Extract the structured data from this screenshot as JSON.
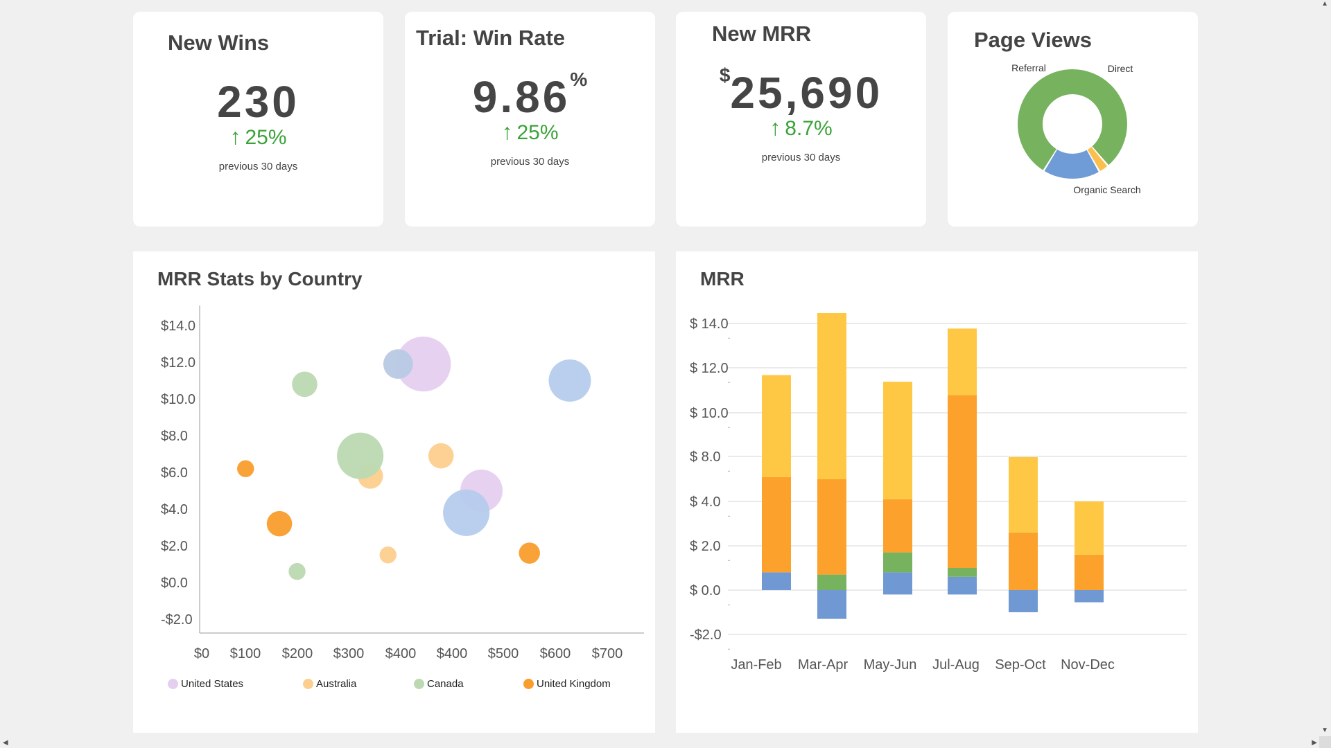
{
  "kpis": {
    "new_wins": {
      "title": "New Wins",
      "value": "230",
      "arrow": "↑",
      "change": "25%",
      "period": "previous 30 days"
    },
    "win_rate": {
      "title": "Trial: Win Rate",
      "value": "9.86",
      "suffix": "%",
      "arrow": "↑",
      "change": "25%",
      "period": "previous 30 days"
    },
    "new_mrr": {
      "title": "New MRR",
      "prefix": "$",
      "value": "25,690",
      "arrow": "↑",
      "change": "8.7%",
      "period": "previous 30 days"
    },
    "accent_color": "#3aa338"
  },
  "page_views": {
    "title": "Page Views"
  },
  "mrr_by_country": {
    "title": "MRR Stats by Country"
  },
  "mrr": {
    "title": "MRR"
  },
  "chart_data": [
    {
      "type": "pie",
      "donut": true,
      "slices": [
        {
          "label": "Organic Search",
          "value": 80,
          "color": "#77b25e"
        },
        {
          "label": "Referral",
          "value": 3,
          "color": "#fdbf4b"
        },
        {
          "label": "Direct",
          "value": 17,
          "color": "#6f9bd6"
        }
      ]
    },
    {
      "type": "scatter",
      "bubble": true,
      "xlim": [
        0,
        700
      ],
      "ylim": [
        -2,
        14
      ],
      "x_ticks": [
        "$0",
        "$100",
        "$200",
        "$300",
        "$400",
        "$400",
        "$500",
        "$600",
        "$700"
      ],
      "y_ticks": [
        "$14.0",
        "$12.0",
        "$10.0",
        "$8.0",
        "$6.0",
        "$4.0",
        "$2.0",
        "$0.0",
        "-$2.0"
      ],
      "grid": false,
      "legend": "bottom",
      "series": [
        {
          "name": "United States",
          "color": "#e5cff0",
          "points": [
            {
              "x": 410,
              "y": 11.9,
              "size": 13
            },
            {
              "x": 525,
              "y": 5.0,
              "size": 10
            }
          ]
        },
        {
          "name": "Australia",
          "color": "#fdcf8e",
          "points": [
            {
              "x": 305,
              "y": 5.8,
              "size": 6
            },
            {
              "x": 340,
              "y": 1.5,
              "size": 4
            },
            {
              "x": 445,
              "y": 6.9,
              "size": 6
            }
          ]
        },
        {
          "name": "Canada",
          "color": "#bcd9b2",
          "points": [
            {
              "x": 175,
              "y": 10.8,
              "size": 6
            },
            {
              "x": 285,
              "y": 6.9,
              "size": 11
            },
            {
              "x": 160,
              "y": 0.6,
              "size": 4
            }
          ]
        },
        {
          "name": "United Kingdom",
          "color": "#f99d2c",
          "points": [
            {
              "x": 58,
              "y": 6.2,
              "size": 4
            },
            {
              "x": 125,
              "y": 3.2,
              "size": 6
            },
            {
              "x": 620,
              "y": 1.6,
              "size": 5
            }
          ]
        },
        {
          "color": "#b8c9e4",
          "points": [
            {
              "x": 360,
              "y": 11.9,
              "size": 7
            }
          ]
        },
        {
          "color": "#b6cbec",
          "points": [
            {
              "x": 495,
              "y": 3.8,
              "size": 11
            },
            {
              "x": 700,
              "y": 11.0,
              "size": 10
            }
          ]
        }
      ]
    },
    {
      "type": "bar",
      "stacked": true,
      "categories": [
        "Jan-Feb",
        "Mar-Apr",
        "May-Jun",
        "Jul-Aug",
        "Sep-Oct",
        "Nov-Dec"
      ],
      "ylim": [
        -2,
        14
      ],
      "y_ticks": [
        "$ 14.0",
        "$ 12.0",
        "$ 10.0",
        "$ 8.0",
        "$ 4.0",
        "$ 2.0",
        "$ 0.0",
        "-$2.0"
      ],
      "grid": true,
      "series": [
        {
          "color": "#7099d4",
          "pos": [
            0.8,
            0,
            0.8,
            0.6,
            0,
            0
          ],
          "neg": [
            0,
            -1.3,
            -0.2,
            -0.2,
            -1.0,
            -0.55
          ]
        },
        {
          "color": "#77b25e",
          "pos": [
            0,
            0.7,
            0.9,
            0.4,
            0,
            0
          ],
          "neg": [
            0,
            0,
            0,
            0,
            0,
            0
          ]
        },
        {
          "color": "#fca12c",
          "pos": [
            4.3,
            4.3,
            2.4,
            7.8,
            2.6,
            1.6
          ],
          "neg": [
            0,
            0,
            0,
            0,
            0,
            0
          ]
        },
        {
          "color": "#fec845",
          "pos": [
            4.6,
            7.5,
            5.3,
            3.0,
            3.4,
            2.4
          ],
          "neg": [
            0,
            0,
            0,
            0,
            0,
            0
          ]
        }
      ]
    }
  ]
}
